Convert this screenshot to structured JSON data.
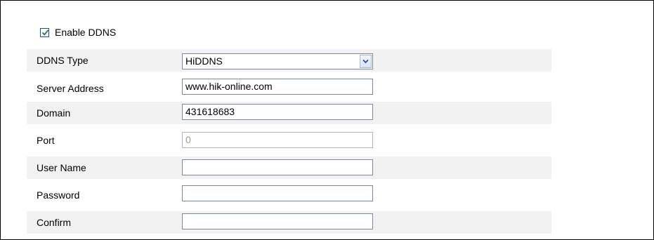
{
  "enable_ddns": {
    "label": "Enable DDNS",
    "checked": true
  },
  "fields": {
    "ddns_type": {
      "label": "DDNS Type",
      "value": "HiDDNS"
    },
    "server_address": {
      "label": "Server Address",
      "value": "www.hik-online.com"
    },
    "domain": {
      "label": "Domain",
      "value": "431618683"
    },
    "port": {
      "label": "Port",
      "value": "0"
    },
    "user_name": {
      "label": "User Name",
      "value": ""
    },
    "password": {
      "label": "Password",
      "value": ""
    },
    "confirm": {
      "label": "Confirm",
      "value": ""
    }
  },
  "icons": {
    "checkbox_mark": "checkmark-icon",
    "dropdown": "chevron-down-icon"
  },
  "colors": {
    "row_shade": "#f2f2f2",
    "input_border": "#7a8a9c",
    "check_color": "#2e7d32"
  }
}
